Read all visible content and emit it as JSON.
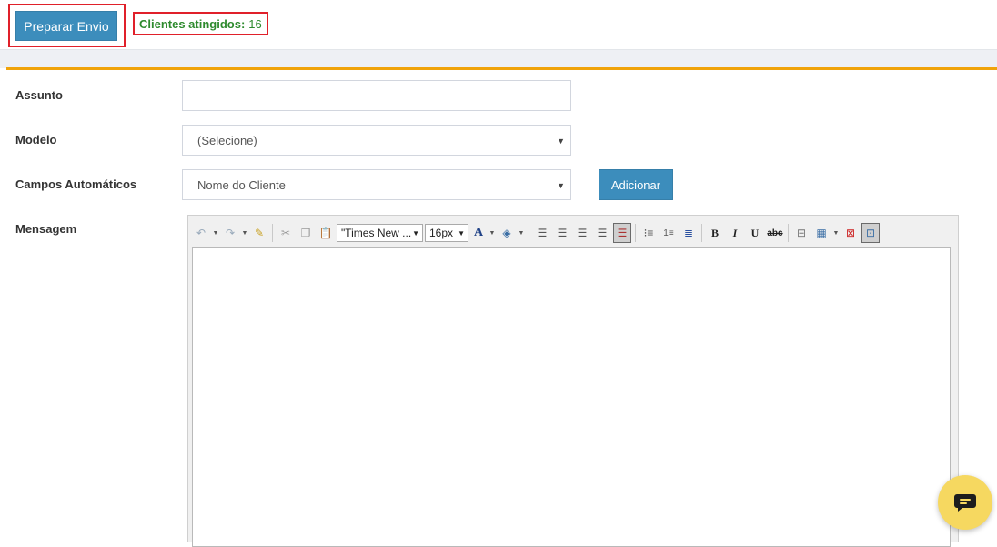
{
  "top": {
    "prepare_button": "Preparar Envio",
    "reach_label": "Clientes atingidos:",
    "reach_value": "16"
  },
  "form": {
    "subject_label": "Assunto",
    "subject_value": "",
    "template_label": "Modelo",
    "template_selected": "(Selecione)",
    "auto_fields_label": "Campos Automáticos",
    "auto_fields_selected": "Nome do Cliente",
    "add_button": "Adicionar",
    "message_label": "Mensagem"
  },
  "editor": {
    "font_family": "\"Times New ...",
    "font_size": "16px",
    "bold": "B",
    "italic": "I",
    "underline": "U",
    "strike": "abc",
    "font_color": "A"
  },
  "colors": {
    "primary": "#3c8dbc",
    "accent": "#f0a30a",
    "highlight": "#e0202a",
    "success": "#2d8a2d",
    "chat": "#f6d860"
  }
}
